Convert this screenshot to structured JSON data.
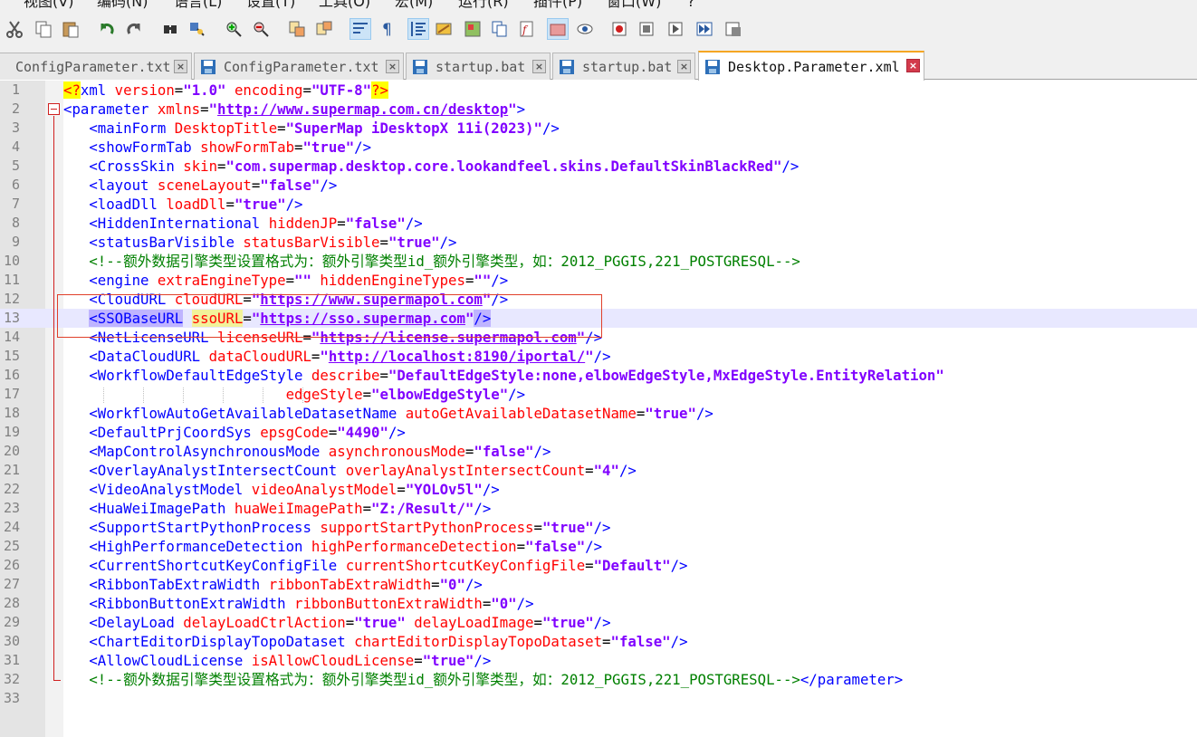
{
  "menu": [
    "视图(V)",
    "编码(N)",
    "语言(L)",
    "设置(T)",
    "工具(O)",
    "宏(M)",
    "运行(R)",
    "插件(P)",
    "窗口(W)",
    "?"
  ],
  "toolbar": {
    "icons": [
      "cut-icon",
      "copy-icon",
      "paste-icon",
      "undo-icon",
      "redo-icon",
      "find-icon",
      "replace-icon",
      "zoom-in-icon",
      "zoom-out-icon",
      "sync-vertical-icon",
      "sync-horizontal-icon",
      "word-wrap-icon",
      "show-all-chars-icon",
      "indent-guide-icon",
      "user-lang-icon",
      "doc-map-icon",
      "doc-list-icon",
      "function-list-icon",
      "folder-workspace-icon",
      "monitoring-icon",
      "record-macro-icon",
      "stop-record-icon",
      "play-macro-icon",
      "run-macro-multiple-icon",
      "save-macro-icon"
    ]
  },
  "tabs": [
    {
      "name": "ConfigParameter.txt",
      "active": false
    },
    {
      "name": "ConfigParameter.txt",
      "active": false
    },
    {
      "name": "startup.bat",
      "active": false
    },
    {
      "name": "startup.bat",
      "active": false
    },
    {
      "name": "Desktop.Parameter.xml",
      "active": true
    }
  ],
  "editor": {
    "current_line": 13,
    "line_numbers": [
      "1",
      "2",
      "3",
      "4",
      "5",
      "6",
      "7",
      "8",
      "9",
      "10",
      "11",
      "12",
      "13",
      "14",
      "15",
      "16",
      "17",
      "18",
      "19",
      "20",
      "21",
      "22",
      "23",
      "24",
      "25",
      "26",
      "27",
      "28",
      "29",
      "30",
      "31",
      "32",
      "33"
    ],
    "lines": [
      [
        [
          "pi",
          "<?"
        ],
        [
          "tag",
          "xml "
        ],
        [
          "attr",
          "version"
        ],
        [
          "eq",
          "="
        ],
        [
          "val",
          "\"1.0\""
        ],
        [
          "txt",
          " "
        ],
        [
          "attr",
          "encoding"
        ],
        [
          "eq",
          "="
        ],
        [
          "val",
          "\"UTF-8\""
        ],
        [
          "pi",
          "?>"
        ]
      ],
      [
        [
          "tag",
          "<parameter "
        ],
        [
          "attr",
          "xmlns"
        ],
        [
          "eq",
          "="
        ],
        [
          "val",
          "\""
        ],
        [
          "url",
          "http://www.supermap.com.cn/desktop"
        ],
        [
          "val",
          "\""
        ],
        [
          "tag",
          ">"
        ]
      ],
      [
        [
          "txt",
          "   "
        ],
        [
          "tag",
          "<mainForm "
        ],
        [
          "attr",
          "DesktopTitle"
        ],
        [
          "eq",
          "="
        ],
        [
          "val",
          "\"SuperMap iDesktopX 11i(2023)\""
        ],
        [
          "tag",
          "/>"
        ]
      ],
      [
        [
          "txt",
          "   "
        ],
        [
          "tag",
          "<showFormTab "
        ],
        [
          "attr",
          "showFormTab"
        ],
        [
          "eq",
          "="
        ],
        [
          "val",
          "\"true\""
        ],
        [
          "tag",
          "/>"
        ]
      ],
      [
        [
          "txt",
          "   "
        ],
        [
          "tag",
          "<CrossSkin "
        ],
        [
          "attr",
          "skin"
        ],
        [
          "eq",
          "="
        ],
        [
          "val",
          "\"com.supermap.desktop.core.lookandfeel.skins.DefaultSkinBlackRed\""
        ],
        [
          "tag",
          "/>"
        ]
      ],
      [
        [
          "txt",
          "   "
        ],
        [
          "tag",
          "<layout "
        ],
        [
          "attr",
          "sceneLayout"
        ],
        [
          "eq",
          "="
        ],
        [
          "val",
          "\"false\""
        ],
        [
          "tag",
          "/>"
        ]
      ],
      [
        [
          "txt",
          "   "
        ],
        [
          "tag",
          "<loadDll "
        ],
        [
          "attr",
          "loadDll"
        ],
        [
          "eq",
          "="
        ],
        [
          "val",
          "\"true\""
        ],
        [
          "tag",
          "/>"
        ]
      ],
      [
        [
          "txt",
          "   "
        ],
        [
          "tag",
          "<HiddenInternational "
        ],
        [
          "attr",
          "hiddenJP"
        ],
        [
          "eq",
          "="
        ],
        [
          "val",
          "\"false\""
        ],
        [
          "tag",
          "/>"
        ]
      ],
      [
        [
          "txt",
          "   "
        ],
        [
          "tag",
          "<statusBarVisible "
        ],
        [
          "attr",
          "statusBarVisible"
        ],
        [
          "eq",
          "="
        ],
        [
          "val",
          "\"true\""
        ],
        [
          "tag",
          "/>"
        ]
      ],
      [
        [
          "txt",
          "   "
        ],
        [
          "cm",
          "<!--额外数据引擎类型设置格式为：额外引擎类型id_额外引擎类型，如：2012_PGGIS,221_POSTGRESQL-->"
        ]
      ],
      [
        [
          "txt",
          "   "
        ],
        [
          "tag",
          "<engine "
        ],
        [
          "attr",
          "extraEngineType"
        ],
        [
          "eq",
          "="
        ],
        [
          "val",
          "\"\""
        ],
        [
          "txt",
          " "
        ],
        [
          "attr",
          "hiddenEngineTypes"
        ],
        [
          "eq",
          "="
        ],
        [
          "val",
          "\"\""
        ],
        [
          "tag",
          "/>"
        ]
      ],
      [
        [
          "txt",
          "   "
        ],
        [
          "tag",
          "<CloudURL "
        ],
        [
          "attr",
          "cloudURL"
        ],
        [
          "eq",
          "="
        ],
        [
          "val",
          "\""
        ],
        [
          "url",
          "https://www.supermapol.com"
        ],
        [
          "val",
          "\""
        ],
        [
          "tag",
          "/>"
        ]
      ],
      [
        [
          "txt",
          "   "
        ],
        [
          "tagh",
          "<SSOBaseURL"
        ],
        [
          "tag",
          " "
        ],
        [
          "attrh",
          "ssoURL"
        ],
        [
          "eq",
          "="
        ],
        [
          "val",
          "\""
        ],
        [
          "url",
          "https://sso.supermap.com"
        ],
        [
          "val",
          "\""
        ],
        [
          "tagh",
          "/>"
        ]
      ],
      [
        [
          "txt",
          "   "
        ],
        [
          "tag",
          "<NetLicenseURL "
        ],
        [
          "attr",
          "licenseURL"
        ],
        [
          "eq",
          "="
        ],
        [
          "val",
          "\""
        ],
        [
          "url",
          "https://license.supermapol.com"
        ],
        [
          "val",
          "\""
        ],
        [
          "tag",
          "/>"
        ]
      ],
      [
        [
          "txt",
          "   "
        ],
        [
          "tag",
          "<DataCloudURL "
        ],
        [
          "attr",
          "dataCloudURL"
        ],
        [
          "eq",
          "="
        ],
        [
          "val",
          "\""
        ],
        [
          "url",
          "http://localhost:8190/iportal/"
        ],
        [
          "val",
          "\""
        ],
        [
          "tag",
          "/>"
        ]
      ],
      [
        [
          "txt",
          "   "
        ],
        [
          "tag",
          "<WorkflowDefaultEdgeStyle "
        ],
        [
          "attr",
          "describe"
        ],
        [
          "eq",
          "="
        ],
        [
          "val",
          "\"DefaultEdgeStyle:none,elbowEdgeStyle,MxEdgeStyle.EntityRelation\""
        ]
      ],
      [
        [
          "txt",
          "                          "
        ],
        [
          "attr",
          "edgeStyle"
        ],
        [
          "eq",
          "="
        ],
        [
          "val",
          "\"elbowEdgeStyle\""
        ],
        [
          "tag",
          "/>"
        ]
      ],
      [
        [
          "txt",
          "   "
        ],
        [
          "tag",
          "<WorkflowAutoGetAvailableDatasetName "
        ],
        [
          "attr",
          "autoGetAvailableDatasetName"
        ],
        [
          "eq",
          "="
        ],
        [
          "val",
          "\"true\""
        ],
        [
          "tag",
          "/>"
        ]
      ],
      [
        [
          "txt",
          "   "
        ],
        [
          "tag",
          "<DefaultPrjCoordSys "
        ],
        [
          "attr",
          "epsgCode"
        ],
        [
          "eq",
          "="
        ],
        [
          "val",
          "\"4490\""
        ],
        [
          "tag",
          "/>"
        ]
      ],
      [
        [
          "txt",
          "   "
        ],
        [
          "tag",
          "<MapControlAsynchronousMode "
        ],
        [
          "attr",
          "asynchronousMode"
        ],
        [
          "eq",
          "="
        ],
        [
          "val",
          "\"false\""
        ],
        [
          "tag",
          "/>"
        ]
      ],
      [
        [
          "txt",
          "   "
        ],
        [
          "tag",
          "<OverlayAnalystIntersectCount "
        ],
        [
          "attr",
          "overlayAnalystIntersectCount"
        ],
        [
          "eq",
          "="
        ],
        [
          "val",
          "\"4\""
        ],
        [
          "tag",
          "/>"
        ]
      ],
      [
        [
          "txt",
          "   "
        ],
        [
          "tag",
          "<VideoAnalystModel "
        ],
        [
          "attr",
          "videoAnalystModel"
        ],
        [
          "eq",
          "="
        ],
        [
          "val",
          "\"YOLOv5l\""
        ],
        [
          "tag",
          "/>"
        ]
      ],
      [
        [
          "txt",
          "   "
        ],
        [
          "tag",
          "<HuaWeiImagePath "
        ],
        [
          "attr",
          "huaWeiImagePath"
        ],
        [
          "eq",
          "="
        ],
        [
          "val",
          "\"Z:/Result/\""
        ],
        [
          "tag",
          "/>"
        ]
      ],
      [
        [
          "txt",
          "   "
        ],
        [
          "tag",
          "<SupportStartPythonProcess "
        ],
        [
          "attr",
          "supportStartPythonProcess"
        ],
        [
          "eq",
          "="
        ],
        [
          "val",
          "\"true\""
        ],
        [
          "tag",
          "/>"
        ]
      ],
      [
        [
          "txt",
          "   "
        ],
        [
          "tag",
          "<HighPerformanceDetection "
        ],
        [
          "attr",
          "highPerformanceDetection"
        ],
        [
          "eq",
          "="
        ],
        [
          "val",
          "\"false\""
        ],
        [
          "tag",
          "/>"
        ]
      ],
      [
        [
          "txt",
          "   "
        ],
        [
          "tag",
          "<CurrentShortcutKeyConfigFile "
        ],
        [
          "attr",
          "currentShortcutKeyConfigFile"
        ],
        [
          "eq",
          "="
        ],
        [
          "val",
          "\"Default\""
        ],
        [
          "tag",
          "/>"
        ]
      ],
      [
        [
          "txt",
          "   "
        ],
        [
          "tag",
          "<RibbonTabExtraWidth "
        ],
        [
          "attr",
          "ribbonTabExtraWidth"
        ],
        [
          "eq",
          "="
        ],
        [
          "val",
          "\"0\""
        ],
        [
          "tag",
          "/>"
        ]
      ],
      [
        [
          "txt",
          "   "
        ],
        [
          "tag",
          "<RibbonButtonExtraWidth "
        ],
        [
          "attr",
          "ribbonButtonExtraWidth"
        ],
        [
          "eq",
          "="
        ],
        [
          "val",
          "\"0\""
        ],
        [
          "tag",
          "/>"
        ]
      ],
      [
        [
          "txt",
          "   "
        ],
        [
          "tag",
          "<DelayLoad "
        ],
        [
          "attr",
          "delayLoadCtrlAction"
        ],
        [
          "eq",
          "="
        ],
        [
          "val",
          "\"true\""
        ],
        [
          "txt",
          " "
        ],
        [
          "attr",
          "delayLoadImage"
        ],
        [
          "eq",
          "="
        ],
        [
          "val",
          "\"true\""
        ],
        [
          "tag",
          "/>"
        ]
      ],
      [
        [
          "txt",
          "   "
        ],
        [
          "tag",
          "<ChartEditorDisplayTopoDataset "
        ],
        [
          "attr",
          "chartEditorDisplayTopoDataset"
        ],
        [
          "eq",
          "="
        ],
        [
          "val",
          "\"false\""
        ],
        [
          "tag",
          "/>"
        ]
      ],
      [
        [
          "txt",
          "   "
        ],
        [
          "tag",
          "<AllowCloudLicense "
        ],
        [
          "attr",
          "isAllowCloudLicense"
        ],
        [
          "eq",
          "="
        ],
        [
          "val",
          "\"true\""
        ],
        [
          "tag",
          "/>"
        ]
      ],
      [
        [
          "txt",
          "   "
        ],
        [
          "cm",
          "<!--额外数据引擎类型设置格式为：额外引擎类型id_额外引擎类型，如：2012_PGGIS,221_POSTGRESQL-->"
        ],
        [
          "tag",
          "</parameter>"
        ]
      ],
      []
    ]
  }
}
